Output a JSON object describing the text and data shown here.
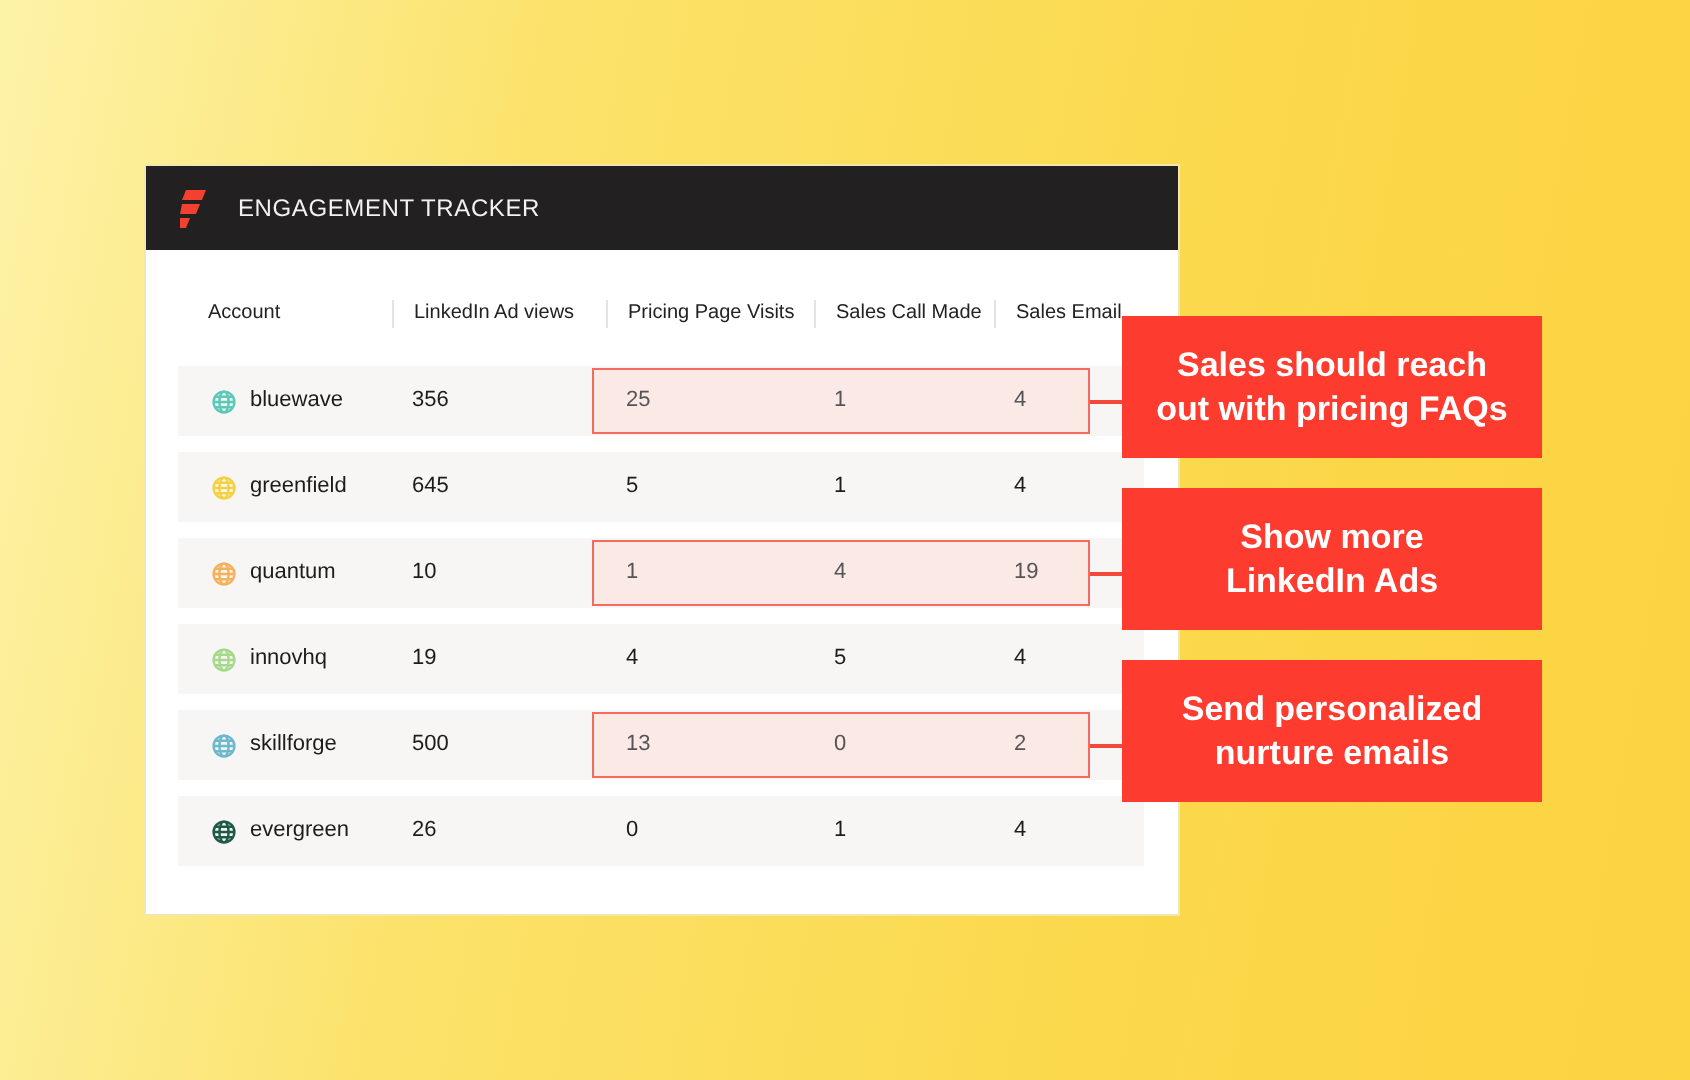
{
  "header": {
    "title": "ENGAGEMENT TRACKER"
  },
  "table": {
    "columns": [
      "Account",
      "LinkedIn Ad views",
      "Pricing Page Visits",
      "Sales Call Made",
      "Sales Email"
    ],
    "rows": [
      {
        "account": "bluewave",
        "color": "#5cc9b8",
        "linkedin_ad_views": "356",
        "pricing_page_visits": "25",
        "sales_call_made": "1",
        "sales_email": "4",
        "highlighted": true,
        "callout": [
          "Sales should reach",
          "out with pricing FAQs"
        ]
      },
      {
        "account": "greenfield",
        "color": "#f5d142",
        "linkedin_ad_views": "645",
        "pricing_page_visits": "5",
        "sales_call_made": "1",
        "sales_email": "4",
        "highlighted": false
      },
      {
        "account": "quantum",
        "color": "#f7b15a",
        "linkedin_ad_views": "10",
        "pricing_page_visits": "1",
        "sales_call_made": "4",
        "sales_email": "19",
        "highlighted": true,
        "callout": [
          "Show more",
          "LinkedIn Ads"
        ]
      },
      {
        "account": "innovhq",
        "color": "#a6d98a",
        "linkedin_ad_views": "19",
        "pricing_page_visits": "4",
        "sales_call_made": "5",
        "sales_email": "4",
        "highlighted": false
      },
      {
        "account": "skillforge",
        "color": "#6cb8cc",
        "linkedin_ad_views": "500",
        "pricing_page_visits": "13",
        "sales_call_made": "0",
        "sales_email": "2",
        "highlighted": true,
        "callout": [
          "Send personalized",
          "nurture emails"
        ]
      },
      {
        "account": "evergreen",
        "color": "#1f5a48",
        "linkedin_ad_views": "26",
        "pricing_page_visits": "0",
        "sales_call_made": "1",
        "sales_email": "4",
        "highlighted": false
      }
    ]
  }
}
